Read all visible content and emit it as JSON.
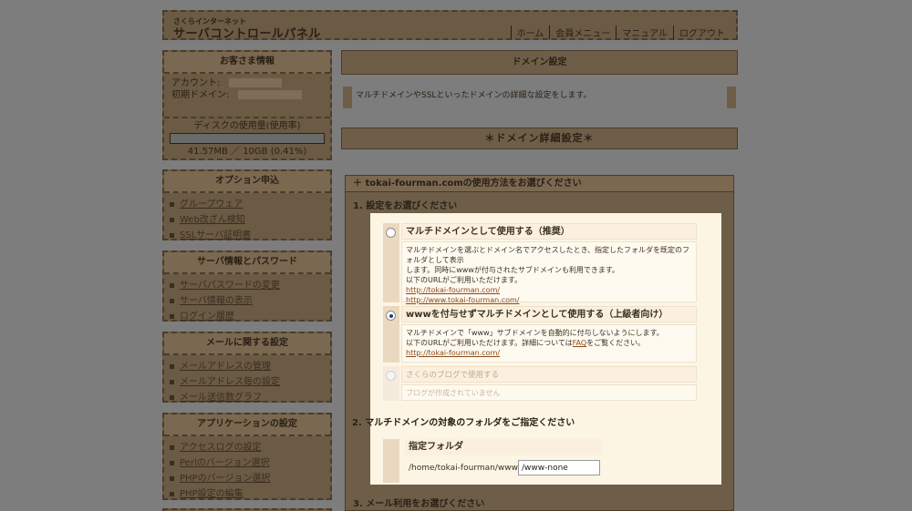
{
  "header": {
    "brand_small": "さくらインターネット",
    "brand_big": "サーバコントロールパネル",
    "nav": [
      "ホーム",
      "会員メニュー",
      "マニュアル",
      "ログアウト"
    ]
  },
  "sidebar": {
    "account": {
      "title": "お客さま情報",
      "account_label": "アカウント:",
      "domain_label": "初期ドメイン:",
      "disk_title": "ディスクの使用量(使用率)",
      "disk_usage": "41.57MB ／ 10GB (0.41%)",
      "disk_percent": 0.41
    },
    "sections": [
      {
        "title": "オプション申込",
        "items": [
          "グループウェア",
          "Web改ざん検知",
          "SSLサーバ証明書"
        ]
      },
      {
        "title": "サーバ情報とパスワード",
        "items": [
          "サーバパスワードの変更",
          "サーバ情報の表示",
          "ログイン履歴"
        ]
      },
      {
        "title": "メールに関する設定",
        "items": [
          "メールアドレスの管理",
          "メールアドレス毎の設定",
          "メール送信数グラフ"
        ]
      },
      {
        "title": "アプリケーションの設定",
        "items": [
          "アクセスログの設定",
          "Perlのバージョン選択",
          "PHPのバージョン選択",
          "PHP設定の編集"
        ]
      }
    ]
  },
  "main": {
    "page_title": "ドメイン設定",
    "description": "マルチドメインやSSLといったドメインの詳細な設定をします。",
    "section_title": "＊ドメイン詳細設定＊",
    "panel_title": "＋ tokai-fourman.comの使用方法をお選びください",
    "step1": "1. 設定をお選びください",
    "step2": "2. マルチドメインの対象のフォルダをご指定ください",
    "step3": "3. メール利用をお選びください",
    "options": [
      {
        "title": "マルチドメインとして使用する（推奨）",
        "lines": [
          "マルチドメインを選ぶとドメイン名でアクセスしたとき、指定したフォルダを既定のフォルダとして表示",
          "します。同時にwwwが付与されたサブドメインも利用できます。",
          "以下のURLがご利用いただけます。"
        ],
        "links": [
          "http://tokai-fourman.com/",
          "http://www.tokai-fourman.com/"
        ],
        "selected": false
      },
      {
        "title": "wwwを付与せずマルチドメインとして使用する（上級者向け）",
        "lines": [
          "マルチドメインで「www」サブドメインを自動的に付与しないようにします。"
        ],
        "line_prefix": "以下のURLがご利用いただけます。詳細については",
        "faq": "FAQ",
        "line_suffix": "をご覧ください。",
        "links": [
          "http://tokai-fourman.com/"
        ],
        "selected": true
      },
      {
        "title": "さくらのブログで使用する",
        "lines": [
          "ブログが作成されていません"
        ],
        "selected": false,
        "disabled": true
      }
    ],
    "folder": {
      "label": "指定フォルダ",
      "path": "/home/tokai-fourman/www",
      "value": "/www-none"
    }
  }
}
